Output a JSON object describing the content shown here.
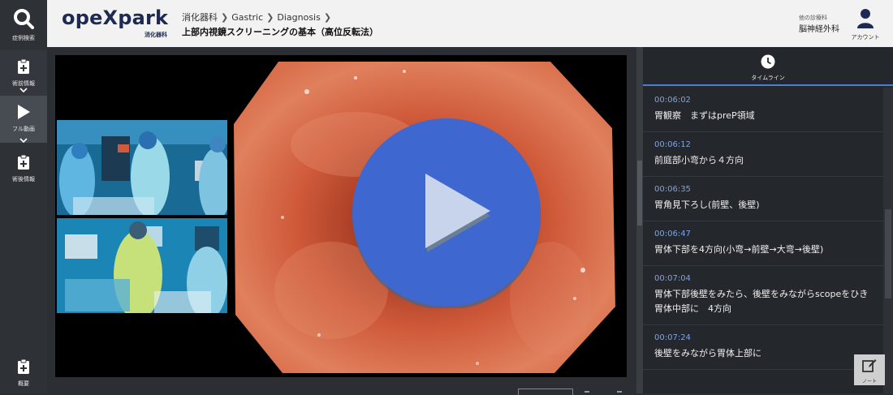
{
  "sidebar": {
    "search_label": "症例検索",
    "preop_label": "術前情報",
    "full_video_label": "フル動画",
    "postop_label": "術後情報",
    "summary_label": "概要"
  },
  "header": {
    "logo": "opeXpark",
    "logo_sub": "消化器科",
    "breadcrumb": [
      "消化器科",
      "Gastric",
      "Diagnosis"
    ],
    "title": "上部内視鏡スクリーニングの基本（高位反転法）",
    "other_dept_label": "他の診療科",
    "other_dept_value": "脳神経外科",
    "account_label": "アカウント"
  },
  "panel": {
    "tab_label": "タイムライン",
    "accent_color": "#4a7fd0",
    "items": [
      {
        "time": "00:06:02",
        "text": "胃観察　まずはpreP領域"
      },
      {
        "time": "00:06:12",
        "text": "前庭部小弯から４方向"
      },
      {
        "time": "00:06:35",
        "text": "胃角見下ろし(前壁、後壁)"
      },
      {
        "time": "00:06:47",
        "text": "胃体下部を4方向(小弯→前壁→大弯→後壁)"
      },
      {
        "time": "00:07:04",
        "text": "胃体下部後壁をみたら、後壁をみながらscopeをひき胃体中部に　4方向"
      },
      {
        "time": "00:07:24",
        "text": "後壁をみながら胃体上部に"
      }
    ],
    "note_label": "ノート"
  },
  "colors": {
    "play_button": "#3e67cf",
    "time_text": "#7ea3e6",
    "header_navy": "#1f2a54"
  }
}
